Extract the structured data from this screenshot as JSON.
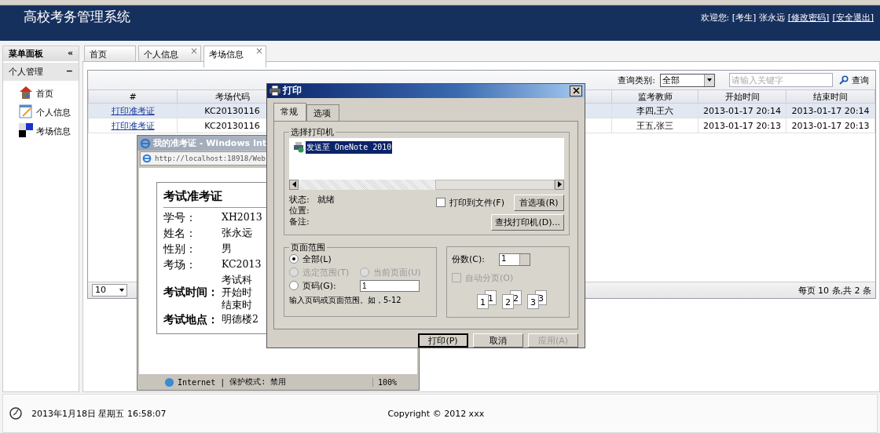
{
  "header": {
    "title": "高校考务管理系统",
    "welcome": "欢迎您: [考生] 张永远",
    "links": [
      "[修改密码]",
      "[安全退出]"
    ]
  },
  "sidebar": {
    "title": "菜单面板",
    "collapse": "«",
    "group": {
      "title": "个人管理",
      "toggle": "−"
    },
    "items": [
      {
        "label": "首页"
      },
      {
        "label": "个人信息"
      },
      {
        "label": "考场信息"
      }
    ]
  },
  "tabs": [
    {
      "label": "首页",
      "selected": false
    },
    {
      "label": "个人信息",
      "close": "×",
      "selected": false
    },
    {
      "label": "考场信息",
      "close": "×",
      "selected": true
    }
  ],
  "toolbar": {
    "filter_label": "查询类别:",
    "filter_value": "全部",
    "search_placeholder": "请输入关键字",
    "search_button": "查询"
  },
  "table": {
    "columns": [
      "#",
      "考场代码",
      "监考教师",
      "开始时间",
      "结束时间"
    ],
    "rows": [
      {
        "selected": true,
        "cells": [
          "打印准考证",
          "KC20130116",
          "李四,王六",
          "2013-01-17 20:14",
          "2013-01-17 20:14"
        ]
      },
      {
        "selected": false,
        "cells": [
          "打印准考证",
          "KC20130116",
          "王五,张三",
          "2013-01-17 20:13",
          "2013-01-17 20:13"
        ]
      }
    ]
  },
  "pager": {
    "page_size": "10",
    "summary": "每页 10 条,共 2 条"
  },
  "footer": {
    "datetime": "2013年1月18日 星期五 16:58:07",
    "copyright": "Copyright © 2012 xxx"
  },
  "browser_popup": {
    "title": "我的准考证 - Windows Int",
    "address": "http://localhost:18918/Web",
    "card": {
      "heading": "考试准考证",
      "fields": [
        {
          "label": "学号：",
          "values": [
            "XH2013"
          ],
          "bold": false
        },
        {
          "label": "姓名：",
          "values": [
            "张永远"
          ],
          "bold": false
        },
        {
          "label": "性别：",
          "values": [
            "男"
          ],
          "bold": false
        },
        {
          "label": "考场：",
          "values": [
            "KC2013"
          ],
          "bold": false
        },
        {
          "label": "考试时间：",
          "values": [
            "考试科",
            "开始时",
            "结束时"
          ],
          "bold": true
        },
        {
          "label": "考试地点：",
          "values": [
            "明德楼2"
          ],
          "bold": true
        }
      ]
    },
    "status": {
      "zone": "Internet",
      "separator": "|",
      "mode": "保护模式: 禁用",
      "zoom": "100%"
    }
  },
  "print_dialog": {
    "title": "打印",
    "tabs": [
      {
        "label": "常规",
        "selected": true
      },
      {
        "label": "选项",
        "selected": false
      }
    ],
    "printer_group": "选择打印机",
    "printers": [
      {
        "name": "发送至 OneNote 2010",
        "selected": true
      }
    ],
    "status_rows": [
      {
        "label": "状态:",
        "value": "就绪"
      },
      {
        "label": "位置:"
      },
      {
        "label": "备注:"
      }
    ],
    "print_to_file": {
      "label": "打印到文件(F)",
      "checked": false
    },
    "preferences": "首选项(R)",
    "find_printer": "查找打印机(D)...",
    "range_group": "页面范围",
    "ranges": [
      {
        "label": "全部(L)",
        "selected": true,
        "disabled": false
      },
      {
        "label": "选定范围(T)",
        "selected": false,
        "disabled": true
      },
      {
        "label": "当前页面(U)",
        "selected": false,
        "disabled": true
      },
      {
        "label": "页码(G):",
        "selected": false,
        "disabled": false
      }
    ],
    "page_input": "1",
    "range_hint": "输入页码或页面范围。如，5-12",
    "copies_label": "份数(C):",
    "copies": "1",
    "collate": {
      "label": "自动分页(O)",
      "checked": false,
      "disabled": true
    },
    "collate_pages": [
      "1",
      "1",
      "2",
      "2",
      "3",
      "3"
    ],
    "buttons": [
      {
        "label": "打印(P)",
        "kind": "default"
      },
      {
        "label": "取消",
        "kind": "normal"
      },
      {
        "label": "应用(A)",
        "kind": "disabled"
      }
    ]
  }
}
